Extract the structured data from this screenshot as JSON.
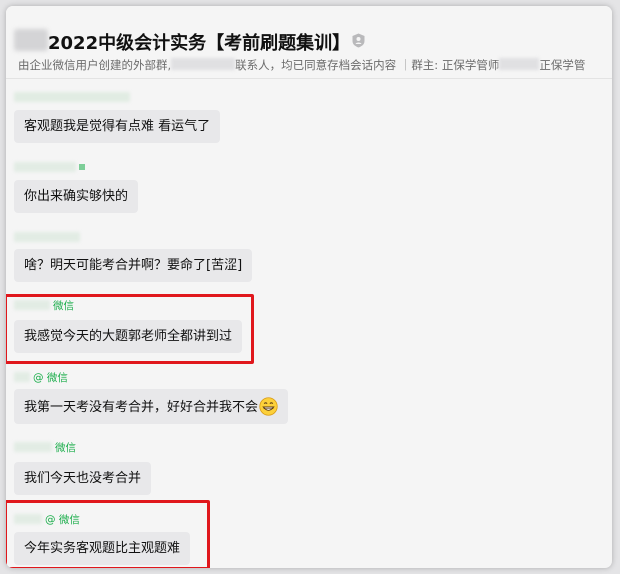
{
  "chat": {
    "title": "2022中级会计实务【考前刷题集训】",
    "subtitle_a": "由企业微信用户创建的外部群,",
    "subtitle_b": "联系人，均已同意存档会话内容",
    "subtitle_sep": "｜",
    "subtitle_owner": "群主: 正保学管师",
    "subtitle_owner2": "正保学管"
  },
  "messages": [
    {
      "sender_tag": "",
      "text": "客观题我是觉得有点难 看运气了"
    },
    {
      "sender_tag": "",
      "text": "你出来确实够快的"
    },
    {
      "sender_tag": "",
      "text": "啥？明天可能考合并啊？要命了[苦涩]"
    },
    {
      "sender_tag": "微信",
      "text": "我感觉今天的大题郭老师全都讲到过"
    },
    {
      "sender_tag": "@ 微信",
      "text": "我第一天考没有考合并，好好合并我不会"
    },
    {
      "sender_tag": "微信",
      "text": "我们今天也没考合并"
    },
    {
      "sender_tag": "@ 微信",
      "text": "今年实务客观题比主观题难"
    }
  ],
  "colors": {
    "highlight": "#e0171c",
    "wechat_green": "#1aad4a",
    "bubble": "#e8e8ea"
  },
  "icons": {
    "group": "group-badge-icon",
    "emoji": "grinning-face-icon"
  }
}
